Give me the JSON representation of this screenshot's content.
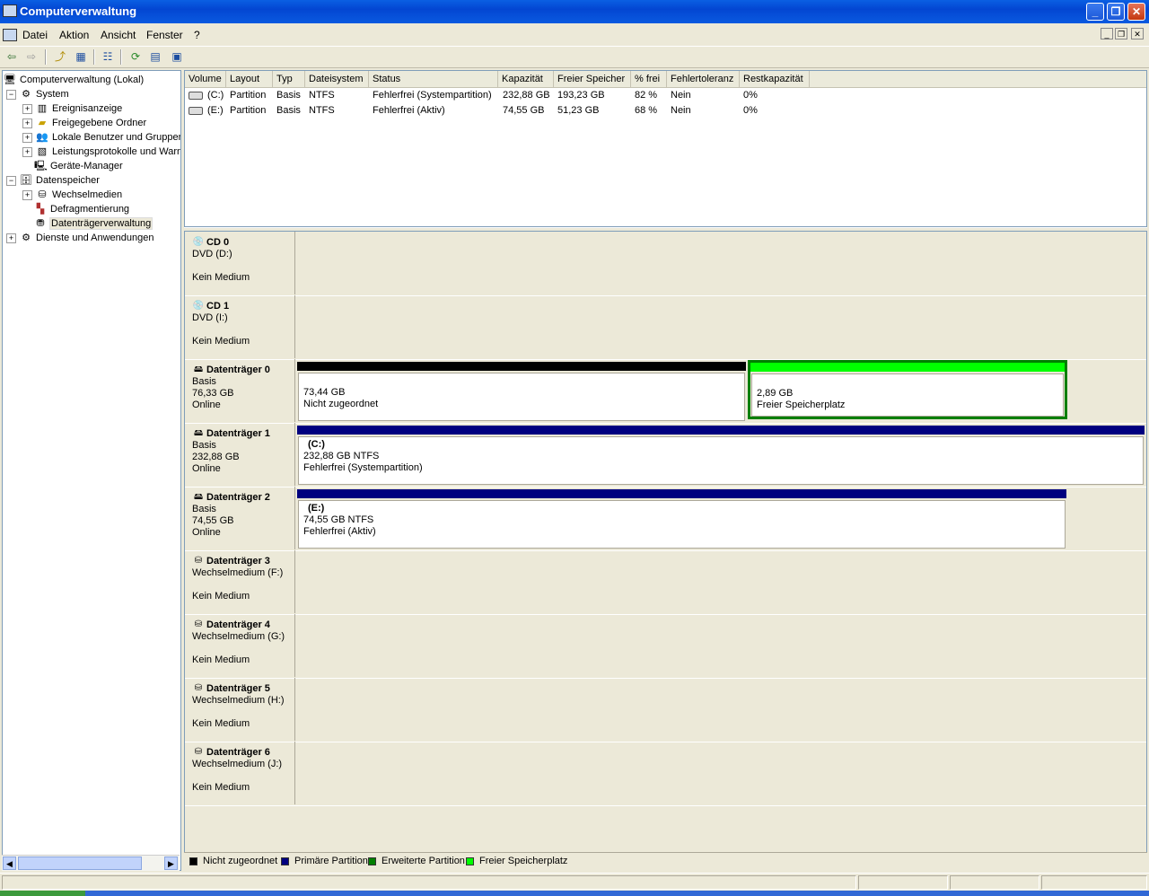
{
  "window": {
    "title": "Computerverwaltung"
  },
  "menu": [
    "Datei",
    "Aktion",
    "Ansicht",
    "Fenster",
    "?"
  ],
  "tree": [
    {
      "label": "Computerverwaltung (Lokal)",
      "icon": "computer-icon"
    },
    {
      "label": "System",
      "icon": "system-tools-icon"
    },
    {
      "label": "Ereignisanzeige",
      "icon": "event-viewer-icon"
    },
    {
      "label": "Freigegebene Ordner",
      "icon": "shared-folder-icon"
    },
    {
      "label": "Lokale Benutzer und Gruppen",
      "icon": "users-icon"
    },
    {
      "label": "Leistungsprotokolle und Warnungen",
      "icon": "performance-icon"
    },
    {
      "label": "Geräte-Manager",
      "icon": "device-manager-icon"
    },
    {
      "label": "Datenspeicher",
      "icon": "storage-icon"
    },
    {
      "label": "Wechselmedien",
      "icon": "removable-storage-icon"
    },
    {
      "label": "Defragmentierung",
      "icon": "defrag-icon"
    },
    {
      "label": "Datenträgerverwaltung",
      "icon": "disk-management-icon"
    },
    {
      "label": "Dienste und Anwendungen",
      "icon": "services-icon"
    }
  ],
  "volumes_table": {
    "columns": [
      "Volume",
      "Layout",
      "Typ",
      "Dateisystem",
      "Status",
      "Kapazität",
      "Freier Speicher",
      "% frei",
      "Fehlertoleranz",
      "Restkapazität"
    ],
    "rows": [
      [
        "(C:)",
        "Partition",
        "Basis",
        "NTFS",
        "Fehlerfrei (Systempartition)",
        "232,88 GB",
        "193,23 GB",
        "82 %",
        "Nein",
        "0%"
      ],
      [
        "(E:)",
        "Partition",
        "Basis",
        "NTFS",
        "Fehlerfrei (Aktiv)",
        "74,55 GB",
        "51,23 GB",
        "68 %",
        "Nein",
        "0%"
      ]
    ]
  },
  "disks": [
    {
      "name": "CD 0",
      "line1": "DVD (D:)",
      "line2": "",
      "line3": "Kein Medium"
    },
    {
      "name": "CD 1",
      "line1": "DVD (I:)",
      "line2": "",
      "line3": "Kein Medium"
    },
    {
      "name": "Datenträger 0",
      "line1": "Basis",
      "line2": "76,33 GB",
      "line3": "Online",
      "volumes": [
        {
          "title": "",
          "size": "73,44 GB",
          "status": "Nicht zugeordnet",
          "color": "#000000"
        },
        {
          "title": "",
          "size": "2,89 GB",
          "status": "Freier Speicherplatz",
          "color": "#00ff00"
        }
      ]
    },
    {
      "name": "Datenträger 1",
      "line1": "Basis",
      "line2": "232,88 GB",
      "line3": "Online",
      "volumes": [
        {
          "title": "(C:)",
          "size": "232,88 GB NTFS",
          "status": "Fehlerfrei (Systempartition)",
          "color": "#00007f"
        }
      ]
    },
    {
      "name": "Datenträger 2",
      "line1": "Basis",
      "line2": "74,55 GB",
      "line3": "Online",
      "volumes": [
        {
          "title": "(E:)",
          "size": "74,55 GB NTFS",
          "status": "Fehlerfrei (Aktiv)",
          "color": "#00007f"
        }
      ]
    },
    {
      "name": "Datenträger 3",
      "line1": "Wechselmedium (F:)",
      "line2": "",
      "line3": "Kein Medium"
    },
    {
      "name": "Datenträger 4",
      "line1": "Wechselmedium (G:)",
      "line2": "",
      "line3": "Kein Medium"
    },
    {
      "name": "Datenträger 5",
      "line1": "Wechselmedium (H:)",
      "line2": "",
      "line3": "Kein Medium"
    },
    {
      "name": "Datenträger 6",
      "line1": "Wechselmedium (J:)",
      "line2": "",
      "line3": "Kein Medium"
    }
  ],
  "legend": [
    {
      "label": "Nicht zugeordnet",
      "color": "#000000"
    },
    {
      "label": "Primäre Partition",
      "color": "#00007f"
    },
    {
      "label": "Erweiterte Partition",
      "color": "#007f00"
    },
    {
      "label": "Freier Speicherplatz",
      "color": "#00ff00"
    }
  ]
}
